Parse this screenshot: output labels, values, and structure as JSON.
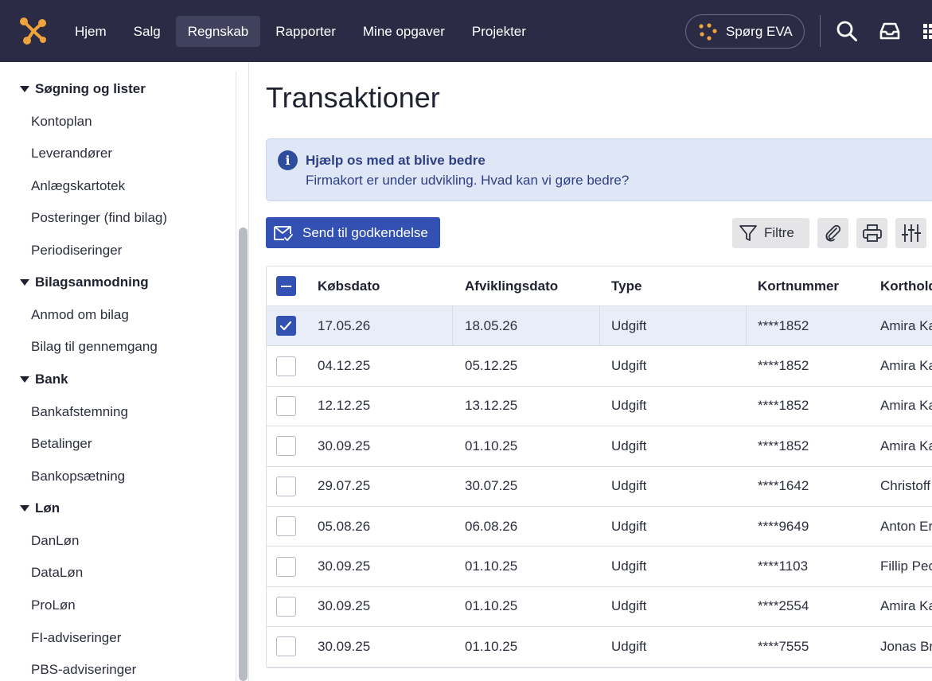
{
  "nav": {
    "items": [
      {
        "label": "Hjem",
        "active": false
      },
      {
        "label": "Salg",
        "active": false
      },
      {
        "label": "Regnskab",
        "active": true
      },
      {
        "label": "Rapporter",
        "active": false
      },
      {
        "label": "Mine opgaver",
        "active": false
      },
      {
        "label": "Projekter",
        "active": false
      }
    ],
    "eva_label": "Spørg EVA"
  },
  "sidebar": {
    "sections": [
      {
        "label": "Søgning og lister",
        "items": [
          "Kontoplan",
          "Leverandører",
          "Anlægskartotek",
          "Posteringer (find bilag)",
          "Periodiseringer"
        ]
      },
      {
        "label": "Bilagsanmodning",
        "items": [
          "Anmod om bilag",
          "Bilag til gennemgang"
        ]
      },
      {
        "label": "Bank",
        "items": [
          "Bankafstemning",
          "Betalinger",
          "Bankopsætning"
        ]
      },
      {
        "label": "Løn",
        "items": [
          "DanLøn",
          "DataLøn",
          "ProLøn",
          "FI-adviseringer",
          "PBS-adviseringer"
        ]
      }
    ]
  },
  "main": {
    "title": "Transaktioner",
    "banner": {
      "title": "Hjælp os med at blive bedre",
      "text": "Firmakort er under udvikling. Hvad kan vi gøre bedre?"
    },
    "send_button": "Send til godkendelse",
    "filter_button": "Filtre"
  },
  "table": {
    "columns": [
      "Købsdato",
      "Afviklingsdato",
      "Type",
      "Kortnummer",
      "Kortholder"
    ],
    "rows": [
      {
        "selected": true,
        "cells": [
          "17.05.26",
          "18.05.26",
          "Udgift",
          "****1852",
          "Amira Ka"
        ]
      },
      {
        "selected": false,
        "cells": [
          "04.12.25",
          "05.12.25",
          "Udgift",
          "****1852",
          "Amira Ka"
        ]
      },
      {
        "selected": false,
        "cells": [
          "12.12.25",
          "13.12.25",
          "Udgift",
          "****1852",
          "Amira Ka"
        ]
      },
      {
        "selected": false,
        "cells": [
          "30.09.25",
          "01.10.25",
          "Udgift",
          "****1852",
          "Amira Ka"
        ]
      },
      {
        "selected": false,
        "cells": [
          "29.07.25",
          "30.07.25",
          "Udgift",
          "****1642",
          "Christoff"
        ]
      },
      {
        "selected": false,
        "cells": [
          "05.08.26",
          "06.08.26",
          "Udgift",
          "****9649",
          "Anton Er"
        ]
      },
      {
        "selected": false,
        "cells": [
          "30.09.25",
          "01.10.25",
          "Udgift",
          "****1103",
          "Fillip Pec"
        ]
      },
      {
        "selected": false,
        "cells": [
          "30.09.25",
          "01.10.25",
          "Udgift",
          "****2554",
          "Amira Ka"
        ]
      },
      {
        "selected": false,
        "cells": [
          "30.09.25",
          "01.10.25",
          "Udgift",
          "****7555",
          "Jonas Br"
        ]
      }
    ]
  },
  "colors": {
    "topbar": "#2b2b46",
    "accent": "#3251b3",
    "banner_bg": "#dfe6f6",
    "logo": "#f0a33a"
  }
}
